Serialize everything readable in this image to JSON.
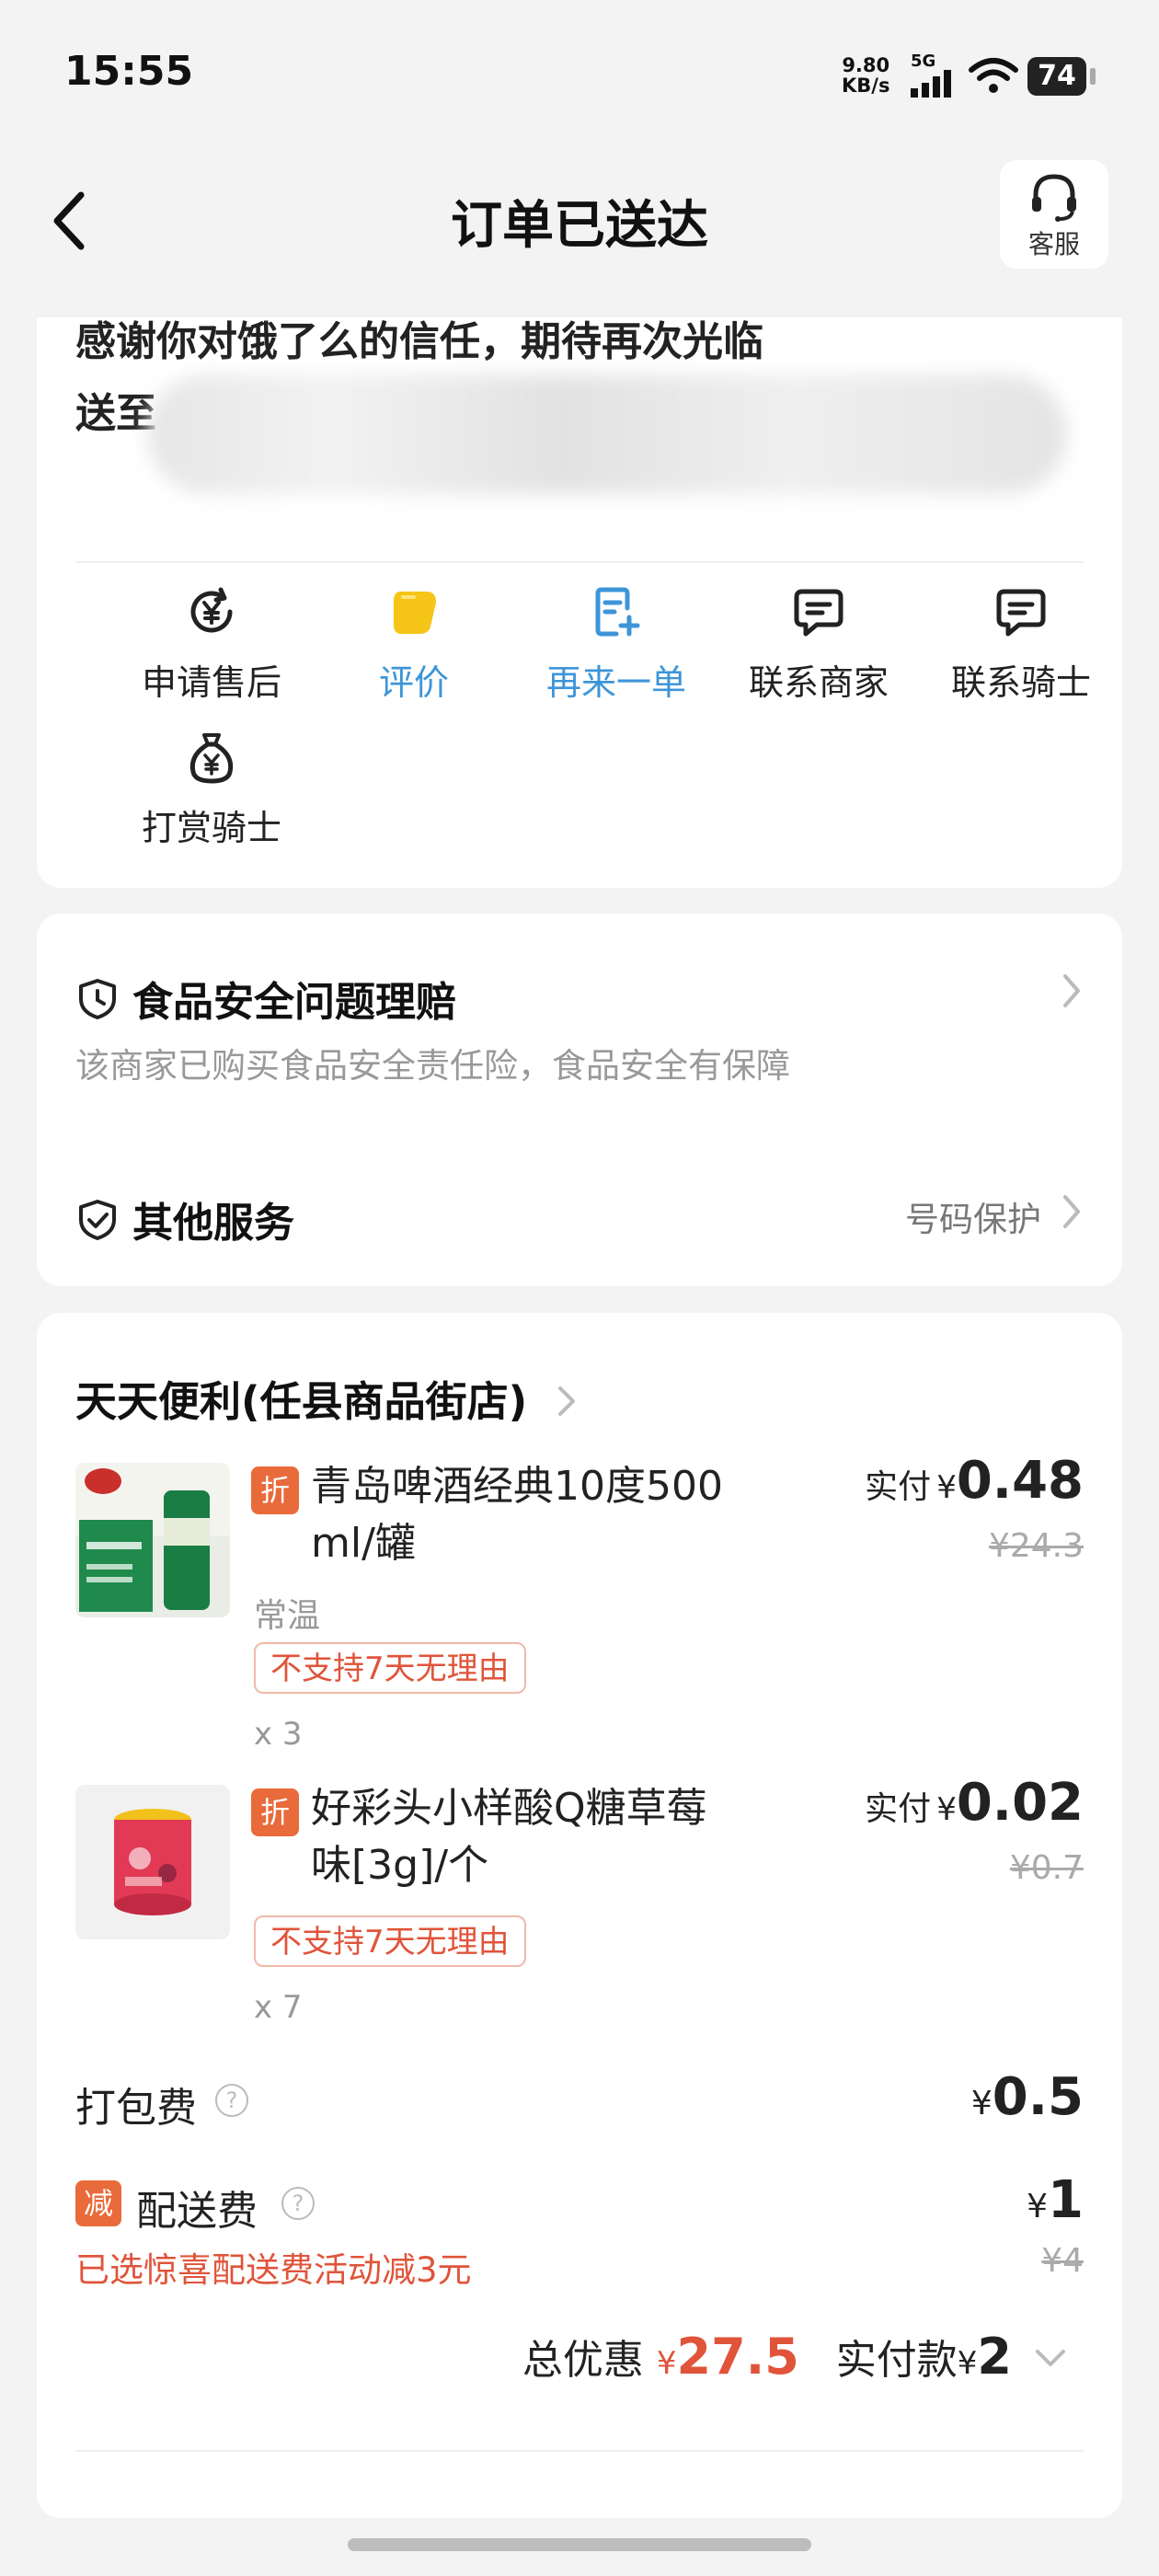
{
  "status": {
    "time": "15:55",
    "net_speed_value": "9.80",
    "net_speed_unit": "KB/s",
    "network": "5G",
    "battery": "74"
  },
  "nav": {
    "title": "订单已送达",
    "service_label": "客服"
  },
  "summary": {
    "thanks_text": "感谢你对饿了么的信任，期待再次光临",
    "deliver_to_label": "送至",
    "actions": [
      {
        "label": "申请售后",
        "icon": "yen-refresh-icon"
      },
      {
        "label": "评价",
        "icon": "rating-icon"
      },
      {
        "label": "再来一单",
        "icon": "reorder-icon"
      },
      {
        "label": "联系商家",
        "icon": "chat-icon"
      },
      {
        "label": "联系骑士",
        "icon": "chat-icon"
      },
      {
        "label": "打赏骑士",
        "icon": "money-bag-icon"
      }
    ]
  },
  "services": {
    "food_safety_title": "食品安全问题理赔",
    "food_safety_sub": "该商家已购买食品安全责任险，食品安全有保障",
    "other_title": "其他服务",
    "other_value": "号码保护"
  },
  "order": {
    "store_name": "天天便利(任县商品街店)",
    "items": [
      {
        "tag": "折",
        "name_line1": "青岛啤酒经典10度500",
        "name_line2": "ml/罐",
        "spec": "常温",
        "badge": "不支持7天无理由",
        "qty": "x 3",
        "paid_label": "实付",
        "currency": "¥",
        "paid": "0.48",
        "original": "¥24.3"
      },
      {
        "tag": "折",
        "name_line1": "好彩头小样酸Q糖草莓",
        "name_line2": "味[3g]/个",
        "badge": "不支持7天无理由",
        "qty": "x 7",
        "paid_label": "实付",
        "currency": "¥",
        "paid": "0.02",
        "original": "¥0.7"
      }
    ],
    "packing_label": "打包费",
    "packing_currency": "¥",
    "packing_fee": "0.5",
    "delivery_tag": "减",
    "delivery_label": "配送费",
    "delivery_currency": "¥",
    "delivery_fee": "1",
    "delivery_original": "¥4",
    "delivery_promo": "已选惊喜配送费活动减3元",
    "total_discount_label": "总优惠",
    "total_discount_currency": "¥",
    "total_discount": "27.5",
    "total_paid_label": "实付款",
    "total_paid_currency": "¥",
    "total_paid": "2"
  },
  "colors": {
    "accent_blue": "#3d95d8",
    "discount_orange": "#e96a3a",
    "promo_red": "#e0543a"
  }
}
